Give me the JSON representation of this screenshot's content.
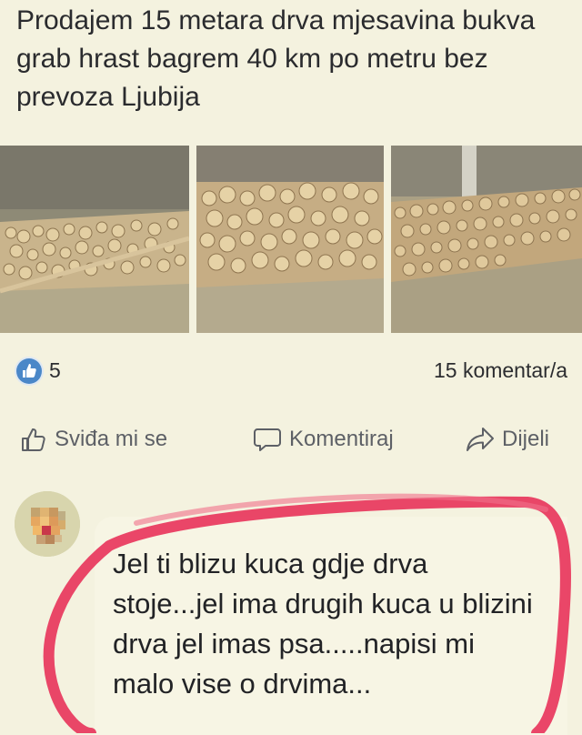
{
  "post": {
    "text": "Prodajem 15 metara drva mjesavina bukva grab hrast bagrem 40 km po metru bez prevoza Ljubija"
  },
  "reactions": {
    "like_count": "5",
    "comment_count": "15 komentar/a",
    "like_icon": "thumbs-up-icon",
    "badge_color": "#4a87c8"
  },
  "actions": {
    "like_label": "Sviđa mi se",
    "comment_label": "Komentiraj",
    "share_label": "Dijeli"
  },
  "comment": {
    "text": "Jel ti blizu kuca gdje drva stoje...jel ima drugih kuca u blizini drva jel imas psa.....napisi mi malo vise o drvima..."
  },
  "colors": {
    "background": "#f4f2df",
    "highlight_circle": "#e8335a"
  }
}
